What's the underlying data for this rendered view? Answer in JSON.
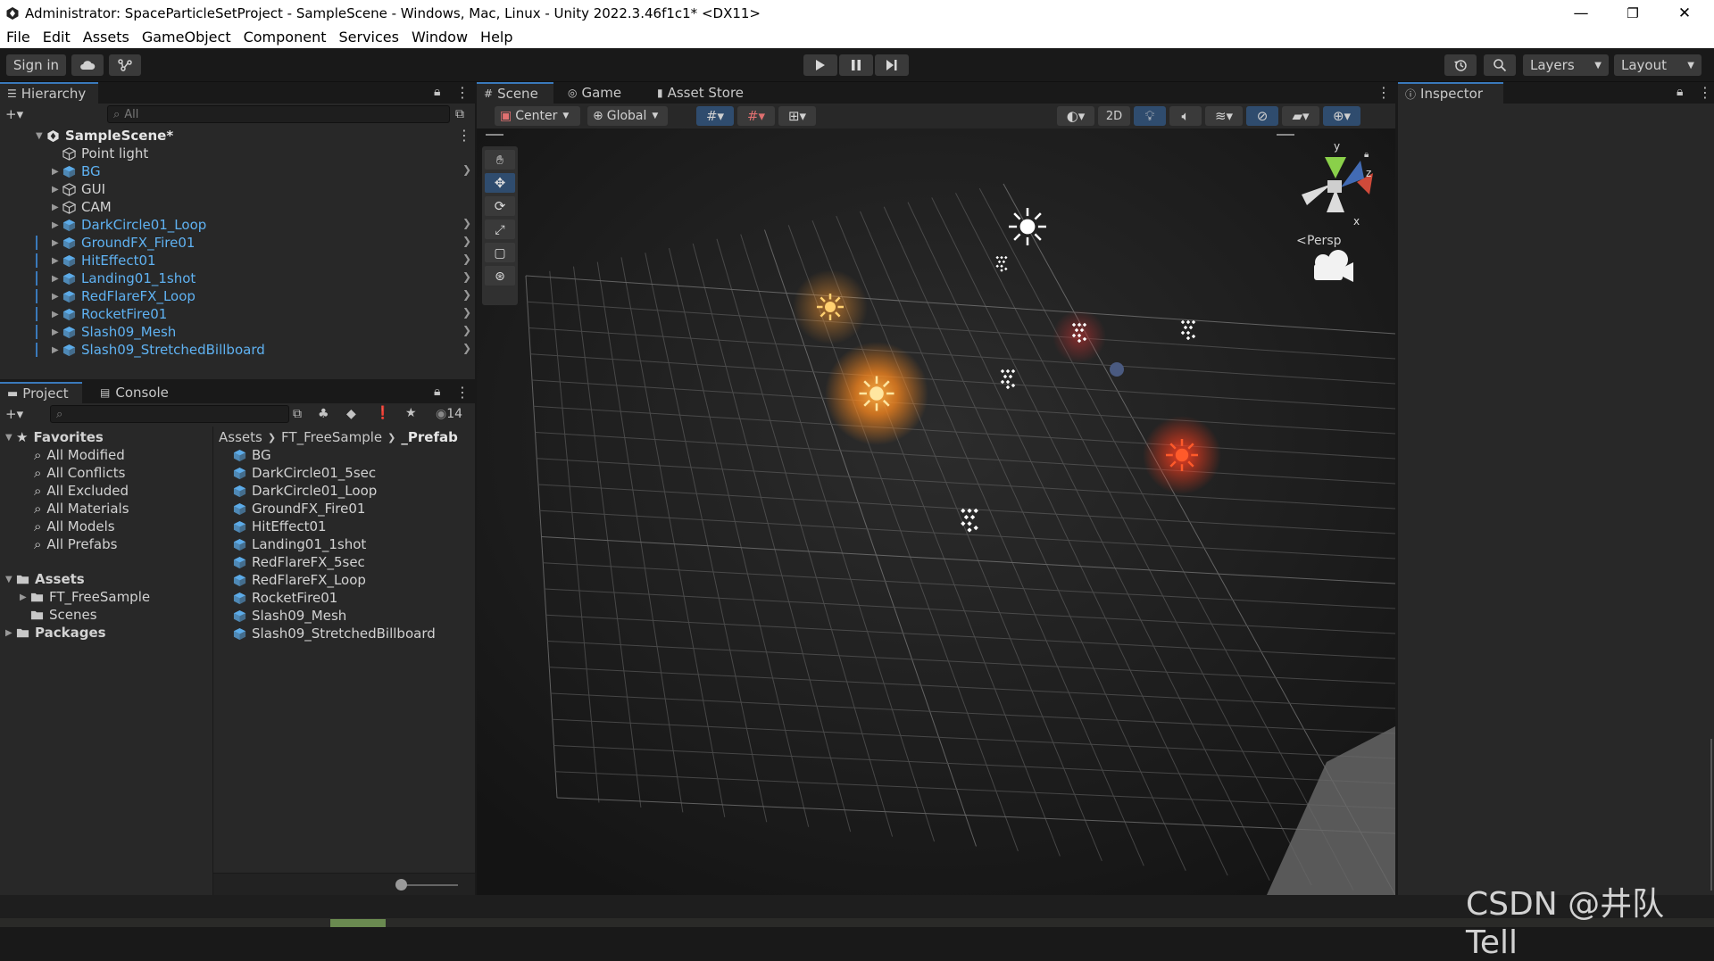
{
  "window": {
    "title": "Administrator: SpaceParticleSetProject - SampleScene - Windows, Mac, Linux - Unity 2022.3.46f1c1* <DX11>",
    "minimize": "—",
    "restore": "❐",
    "close": "✕"
  },
  "menu": [
    "File",
    "Edit",
    "Assets",
    "GameObject",
    "Component",
    "Services",
    "Window",
    "Help"
  ],
  "toolbar": {
    "sign_in": "Sign in",
    "layers": "Layers",
    "layout": "Layout"
  },
  "hierarchy": {
    "tab": "Hierarchy",
    "search_placeholder": "All",
    "scene": "SampleScene*",
    "items": [
      {
        "label": "Point light",
        "blue": false,
        "prefab": false,
        "arrow": false,
        "more": false
      },
      {
        "label": "BG",
        "blue": true,
        "prefab": true,
        "arrow": true,
        "more": true
      },
      {
        "label": "GUI",
        "blue": false,
        "prefab": false,
        "arrow": true,
        "more": false
      },
      {
        "label": "CAM",
        "blue": false,
        "prefab": false,
        "arrow": true,
        "more": false
      },
      {
        "label": "DarkCircle01_Loop",
        "blue": true,
        "prefab": true,
        "arrow": true,
        "more": true
      },
      {
        "label": "GroundFX_Fire01",
        "blue": true,
        "prefab": true,
        "arrow": true,
        "more": true
      },
      {
        "label": "HitEffect01",
        "blue": true,
        "prefab": true,
        "arrow": true,
        "more": true
      },
      {
        "label": "Landing01_1shot",
        "blue": true,
        "prefab": true,
        "arrow": true,
        "more": true
      },
      {
        "label": "RedFlareFX_Loop",
        "blue": true,
        "prefab": true,
        "arrow": true,
        "more": true
      },
      {
        "label": "RocketFire01",
        "blue": true,
        "prefab": true,
        "arrow": true,
        "more": true
      },
      {
        "label": "Slash09_Mesh",
        "blue": true,
        "prefab": true,
        "arrow": true,
        "more": true
      },
      {
        "label": "Slash09_StretchedBillboard",
        "blue": true,
        "prefab": true,
        "arrow": true,
        "more": true
      }
    ]
  },
  "project": {
    "tab_project": "Project",
    "tab_console": "Console",
    "count": "14",
    "favorites_label": "Favorites",
    "favorites": [
      "All Modified",
      "All Conflicts",
      "All Excluded",
      "All Materials",
      "All Models",
      "All Prefabs"
    ],
    "assets_label": "Assets",
    "assets_children": [
      "FT_FreeSample",
      "Scenes"
    ],
    "packages_label": "Packages",
    "breadcrumb": [
      "Assets",
      "FT_FreeSample",
      "_Prefab"
    ],
    "files": [
      "BG",
      "DarkCircle01_5sec",
      "DarkCircle01_Loop",
      "GroundFX_Fire01",
      "HitEffect01",
      "Landing01_1shot",
      "RedFlareFX_5sec",
      "RedFlareFX_Loop",
      "RocketFire01",
      "Slash09_Mesh",
      "Slash09_StretchedBillboard"
    ]
  },
  "scene": {
    "tab_scene": "Scene",
    "tab_game": "Game",
    "tab_store": "Asset Store",
    "pivot": "Center",
    "space": "Global",
    "mode_2d": "2D",
    "persp": "Persp",
    "axis_y": "y",
    "axis_z": "z",
    "axis_x": "x"
  },
  "inspector": {
    "tab": "Inspector"
  },
  "watermark": "CSDN @井队Tell",
  "colors": {
    "accent": "#3a79bb",
    "prefab_blue": "#5fb2f2",
    "panel": "#282828",
    "glow_orange": "#ff8a1e",
    "glow_red": "#ff3a1a"
  }
}
